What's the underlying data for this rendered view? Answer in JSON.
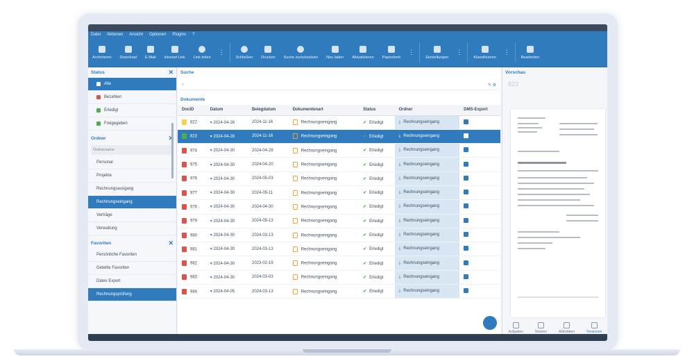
{
  "menu": [
    "Datei",
    "Aktionen",
    "Ansicht",
    "Optionen",
    "Plugins",
    "?"
  ],
  "toolbar": [
    {
      "label": "Archivieren",
      "icon": "archive-icon"
    },
    {
      "label": "Download",
      "icon": "download-icon"
    },
    {
      "label": "E-Mail",
      "icon": "mail-icon"
    },
    {
      "label": "Intranet Link",
      "icon": "link-icon"
    },
    {
      "label": "Link teilen",
      "icon": "share-icon"
    },
    {
      "label": "Schließen",
      "icon": "close-icon"
    },
    {
      "label": "Drucken",
      "icon": "print-icon"
    },
    {
      "label": "Suche zurücksetzen",
      "icon": "reset-icon"
    },
    {
      "label": "Neu laden",
      "icon": "reload-icon"
    },
    {
      "label": "Aktualisieren",
      "icon": "refresh-icon"
    },
    {
      "label": "Papierkorb",
      "icon": "trash-icon"
    },
    {
      "label": "Einstellungen",
      "icon": "gear-icon"
    },
    {
      "label": "Klassifizieren",
      "icon": "classify-icon"
    },
    {
      "label": "Bearbeiten",
      "icon": "edit-icon"
    }
  ],
  "status_panel": {
    "title": "Status",
    "items": [
      {
        "label": "Alle",
        "selected": true
      },
      {
        "label": "Bezahlen",
        "selected": false
      },
      {
        "label": "Erledigt",
        "selected": false
      },
      {
        "label": "Freigegeben",
        "selected": false
      }
    ]
  },
  "ordner_panel": {
    "title": "Ordner",
    "filter": "Ordnername",
    "items": [
      {
        "label": "Personal",
        "selected": false
      },
      {
        "label": "Projekte",
        "selected": false
      },
      {
        "label": "Rechnungsausgang",
        "selected": false
      },
      {
        "label": "Rechnungseingang",
        "selected": true
      },
      {
        "label": "Verträge",
        "selected": false
      },
      {
        "label": "Verwaltung",
        "selected": false
      }
    ]
  },
  "favoriten_panel": {
    "title": "Favoriten",
    "items": [
      {
        "label": "Persönliche Favoriten",
        "selected": false
      },
      {
        "label": "Geteilte Favoriten",
        "selected": false
      },
      {
        "label": "Datev Export",
        "selected": false
      },
      {
        "label": "Rechnungsprüfung",
        "selected": true
      }
    ]
  },
  "search": {
    "title": "Suche",
    "placeholder": ""
  },
  "documents": {
    "title": "Dokumente",
    "columns": [
      "DocID",
      "Datum",
      "Belegdatum",
      "Dokumentenart",
      "Status",
      "Ordner",
      "DMS-Export"
    ],
    "rows": [
      {
        "id": "822",
        "datum": "2024-04-28",
        "beleg": "2024-11-16",
        "art": "Rechnungseingang",
        "status": "Erledigt",
        "ordner": "Rechnungseingang",
        "type": "yellow",
        "selected": false
      },
      {
        "id": "823",
        "datum": "2024-04-28",
        "beleg": "2024-11-16",
        "art": "Rechnungseingang",
        "status": "Erledigt",
        "ordner": "Rechnungseingang",
        "type": "green",
        "selected": true
      },
      {
        "id": "974",
        "datum": "2024-04-30",
        "beleg": "2024-04-29",
        "art": "Rechnungseingang",
        "status": "Erledigt",
        "ordner": "Rechnungseingang",
        "type": "pdf",
        "selected": false
      },
      {
        "id": "975",
        "datum": "2024-04-30",
        "beleg": "2024-04-20",
        "art": "Rechnungseingang",
        "status": "Erledigt",
        "ordner": "Rechnungseingang",
        "type": "pdf",
        "selected": false
      },
      {
        "id": "976",
        "datum": "2024-04-30",
        "beleg": "2024-05-03",
        "art": "Rechnungseingang",
        "status": "Erledigt",
        "ordner": "Rechnungseingang",
        "type": "pdf",
        "selected": false
      },
      {
        "id": "977",
        "datum": "2024-04-30",
        "beleg": "2024-05-11",
        "art": "Rechnungseingang",
        "status": "Erledigt",
        "ordner": "Rechnungseingang",
        "type": "pdf",
        "selected": false
      },
      {
        "id": "978",
        "datum": "2024-04-30",
        "beleg": "2024-04-30",
        "art": "Rechnungseingang",
        "status": "Erledigt",
        "ordner": "Rechnungseingang",
        "type": "pdf",
        "selected": false
      },
      {
        "id": "979",
        "datum": "2024-04-30",
        "beleg": "2024-05-13",
        "art": "Rechnungseingang",
        "status": "Erledigt",
        "ordner": "Rechnungseingang",
        "type": "pdf",
        "selected": false
      },
      {
        "id": "980",
        "datum": "2024-04-30",
        "beleg": "2024-03-13",
        "art": "Rechnungseingang",
        "status": "Erledigt",
        "ordner": "Rechnungseingang",
        "type": "pdf",
        "selected": false
      },
      {
        "id": "981",
        "datum": "2024-04-30",
        "beleg": "2024-03-13",
        "art": "Rechnungseingang",
        "status": "Erledigt",
        "ordner": "Rechnungseingang",
        "type": "pdf",
        "selected": false
      },
      {
        "id": "982",
        "datum": "2024-04-30",
        "beleg": "2023-02-19",
        "art": "Rechnungseingang",
        "status": "Erledigt",
        "ordner": "Rechnungseingang",
        "type": "pdf",
        "selected": false
      },
      {
        "id": "983",
        "datum": "2024-04-30",
        "beleg": "2024-03-03",
        "art": "Rechnungseingang",
        "status": "Erledigt",
        "ordner": "Rechnungseingang",
        "type": "pdf",
        "selected": false
      },
      {
        "id": "984",
        "datum": "2024-04-05",
        "beleg": "2024-03-13",
        "art": "Rechnungseingang",
        "status": "Erledigt",
        "ordner": "Rechnungseingang",
        "type": "pdf",
        "selected": false
      }
    ]
  },
  "preview": {
    "title": "Vorschau",
    "doc_id": "823",
    "actions": [
      "Aufgaben",
      "Notizen",
      "Aktivitäten",
      "Versionen"
    ]
  },
  "colors": {
    "accent": "#2f7bbd",
    "success": "#4cae4c",
    "pdf": "#d9534f",
    "doc": "#f0a23a"
  }
}
